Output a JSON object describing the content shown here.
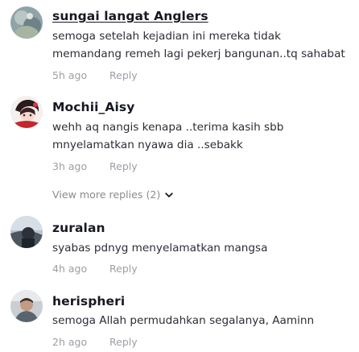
{
  "comments": [
    {
      "username": "sungai langat Anglers",
      "lines": [
        "semoga setelah kejadian ini mereka tidak",
        "memandang remeh lagi pekerj bangunan..tq sahabat"
      ],
      "time": "5h ago",
      "reply_label": "Reply"
    },
    {
      "username": "Mochii_Aisy",
      "lines": [
        "wehh aq nangis kenapa ..terima kasih sbb",
        "mnyelamatkan nyawa dia ..sebakk"
      ],
      "time": "3h ago",
      "reply_label": "Reply",
      "view_more": "View more replies (2)"
    },
    {
      "username": "zuralan",
      "lines": [
        "syabas pdnyg menyelamatkan mangsa"
      ],
      "time": "4h ago",
      "reply_label": "Reply"
    },
    {
      "username": "herispheri",
      "lines": [
        "semoga Allah permudahkan segalanya, Aaminn"
      ],
      "time": "2h ago",
      "reply_label": "Reply"
    }
  ],
  "icons": {
    "view_more_chevron": "chevron-down-icon"
  }
}
